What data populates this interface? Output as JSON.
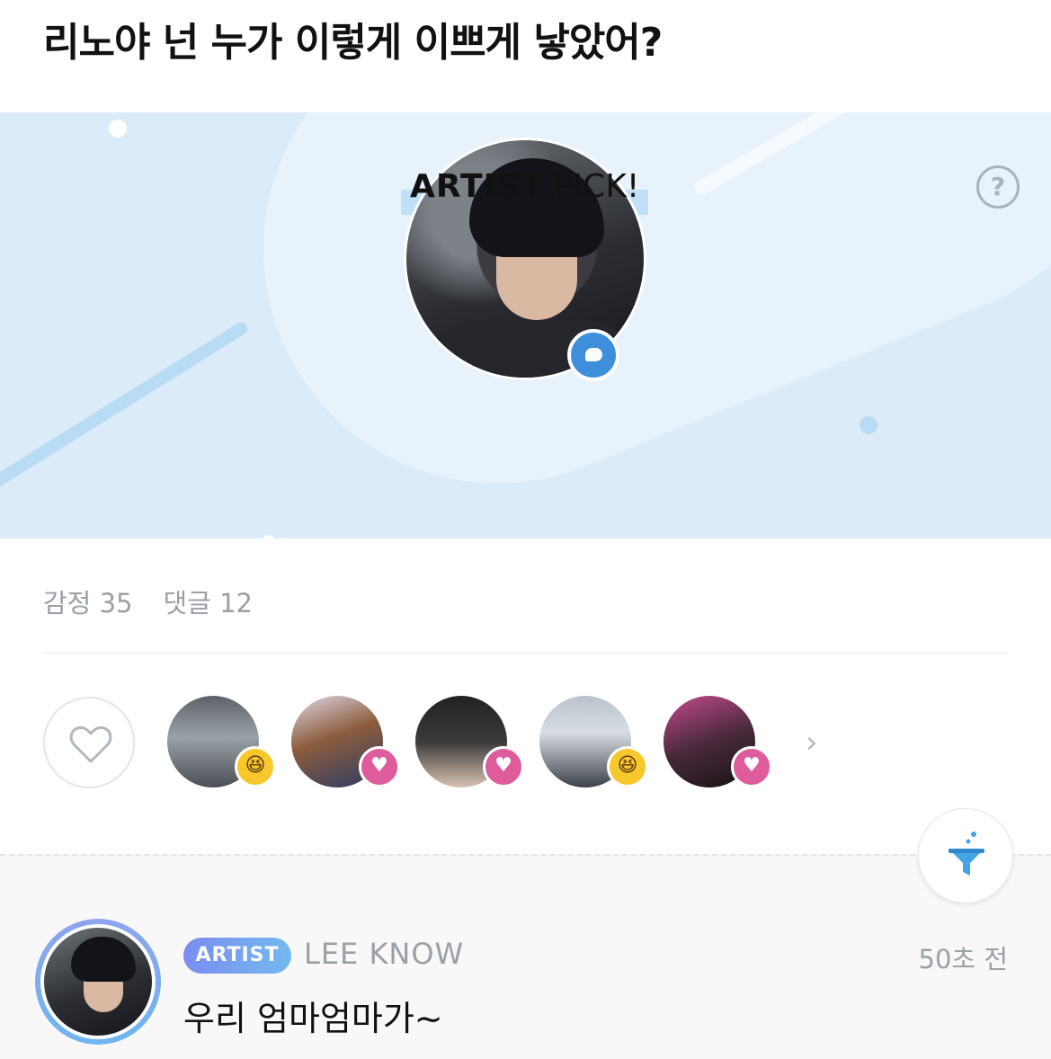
{
  "post": {
    "title": "리노야 넌 누가 이렇게 이쁘게 낳았어?"
  },
  "banner": {
    "pick_strong": "ARTIST",
    "pick_rest": " PICK!",
    "help_symbol": "?"
  },
  "stats": {
    "emotions": "감정 35",
    "comments": "댓글 12"
  },
  "reactions": [
    {
      "type": "smile-emoji",
      "symbol": "😆"
    },
    {
      "type": "heart",
      "symbol": "♥"
    },
    {
      "type": "heart",
      "symbol": "♥"
    },
    {
      "type": "smile-emoji",
      "symbol": "😆"
    },
    {
      "type": "heart",
      "symbol": "♥"
    }
  ],
  "more_symbol": "›",
  "comment": {
    "badge": "ARTIST",
    "author": "LEE KNOW",
    "time": "50초 전",
    "text": "우리 엄마엄마가~"
  },
  "colors": {
    "banner_bg": "#dcebf8",
    "accent_blue": "#3d8fdc",
    "heart_pink": "#de5b9c",
    "emoji_yellow": "#f8c72c"
  }
}
